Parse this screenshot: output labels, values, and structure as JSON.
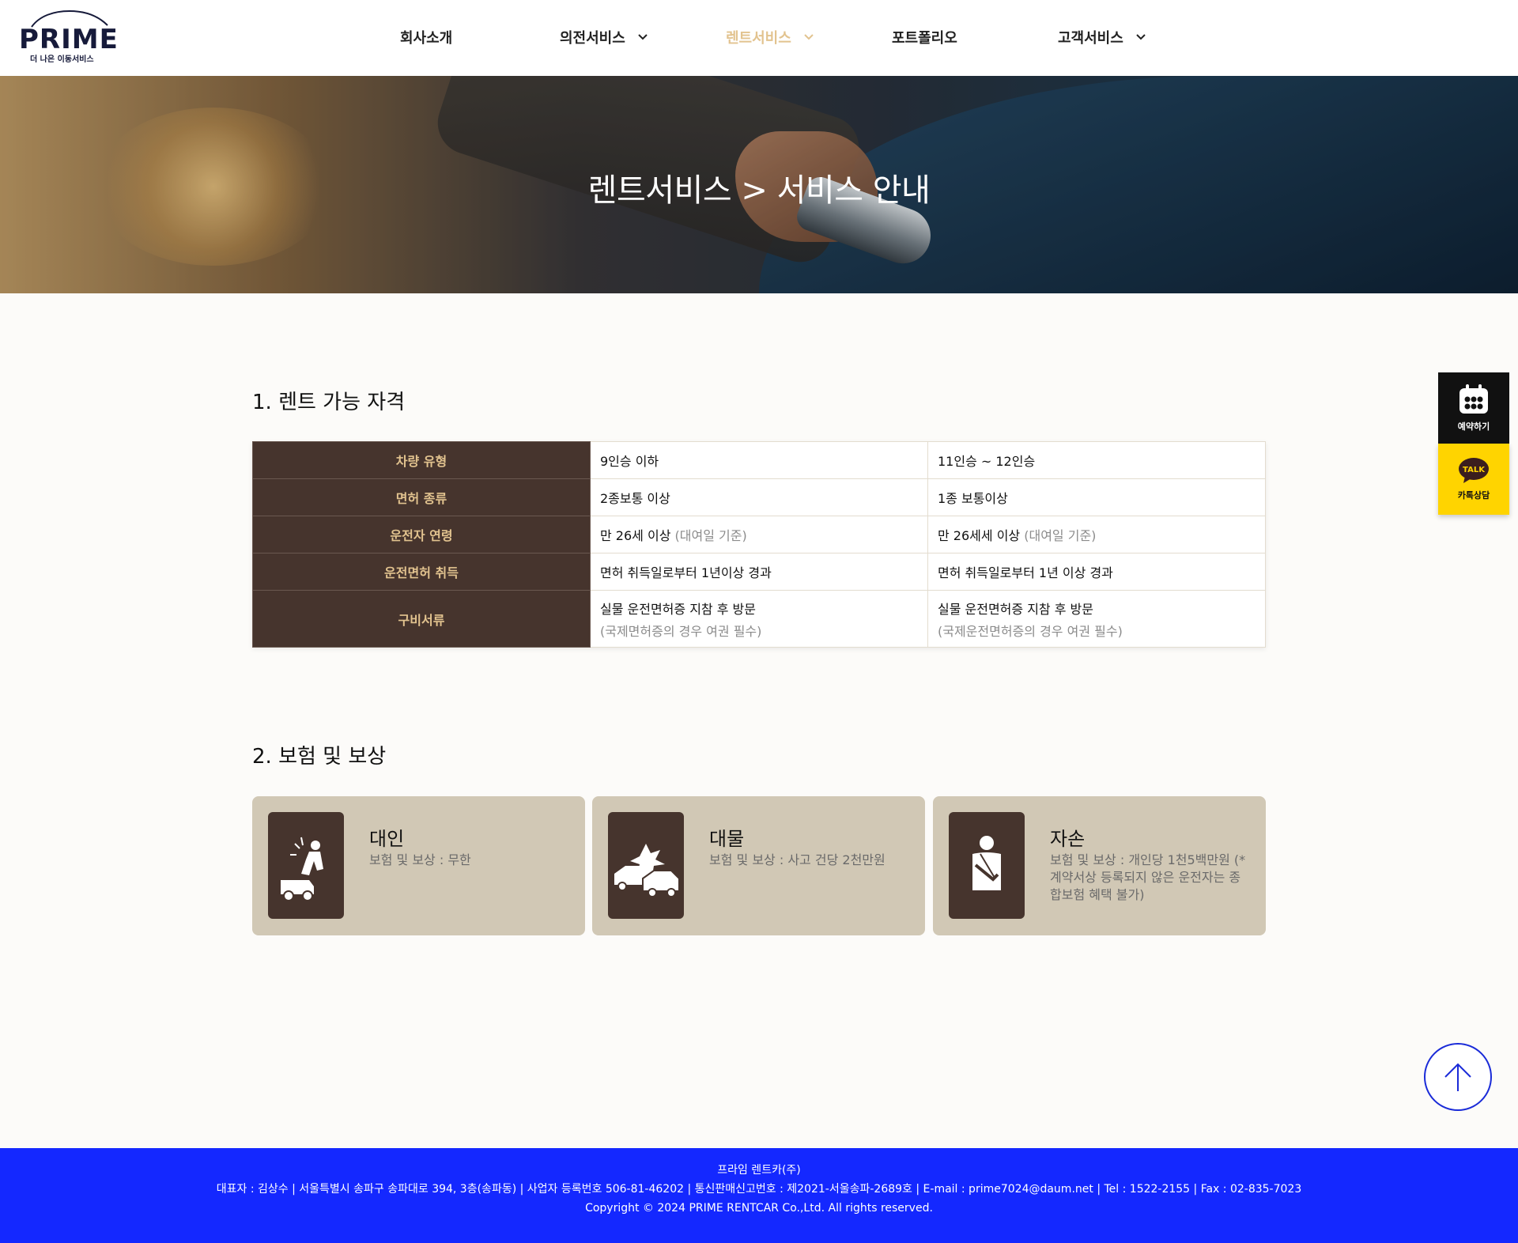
{
  "header": {
    "logo": {
      "word": "PRIME",
      "tagline": "더 나은 이동서비스"
    },
    "nav": [
      {
        "label": "회사소개",
        "has_dropdown": false,
        "active": false
      },
      {
        "label": "의전서비스",
        "has_dropdown": true,
        "active": false
      },
      {
        "label": "렌트서비스",
        "has_dropdown": true,
        "active": true
      },
      {
        "label": "포트폴리오",
        "has_dropdown": false,
        "active": false
      },
      {
        "label": "고객서비스",
        "has_dropdown": true,
        "active": false
      }
    ]
  },
  "hero": {
    "title": "렌트서비스 > 서비스 안내"
  },
  "section1": {
    "title": "1. 렌트 가능 자격",
    "rows": [
      {
        "header": "차량 유형",
        "col1": "9인승 이하",
        "col1_note": "",
        "col2": "11인승 ~ 12인승",
        "col2_note": ""
      },
      {
        "header": "면허 종류",
        "col1": "2종보통 이상",
        "col1_note": "",
        "col2": "1종 보통이상",
        "col2_note": ""
      },
      {
        "header": "운전자 연령",
        "col1": "만 26세 이상",
        "col1_note": "(대여일 기준)",
        "col2": "만 26세세 이상",
        "col2_note": "(대여일 기준)"
      },
      {
        "header": "운전면허 취득",
        "col1": "면허 취득일로부터 1년이상 경과",
        "col1_note": "",
        "col2": "면허 취득일로부터 1년 이상 경과",
        "col2_note": ""
      },
      {
        "header": "구비서류",
        "col1": "실물 운전면허증 지참 후 방문",
        "col1_note": "(국제면허증의 경우 여권 필수)",
        "col2": "실물 운전면허증 지참 후 방문",
        "col2_note": "(국제운전면허증의 경우 여권 필수)"
      }
    ]
  },
  "section2": {
    "title": "2. 보험 및 보상",
    "cards": [
      {
        "title": "대인",
        "desc": "보험 및 보상 : 무한",
        "icon": "injured-person-car-icon"
      },
      {
        "title": "대물",
        "desc": "보험 및 보상 : 사고 건당 2천만원",
        "icon": "car-collision-icon"
      },
      {
        "title": "자손",
        "desc": "보험 및 보상 : 개인당 1천5백만원 (*계약서상 등록되지 않은 운전자는 종합보험 혜택 불가)",
        "icon": "arm-sling-icon"
      }
    ]
  },
  "side": {
    "reserve_label": "예약하기",
    "talk_badge": "TALK",
    "talk_label": "카톡상담"
  },
  "footer": {
    "company": "프라임 렌트카(주)",
    "info": "대표자 : 김상수 | 서울특별시 송파구 송파대로 394, 3층(송파동) | 사업자 등록번호 506-81-46202 | 통신판매신고번호 : 제2021-서울송파-2689호 | E-mail : prime7024@daum.net | Tel : 1522-2155 | Fax : 02-835-7023",
    "copyright": "Copyright © 2024 PRIME RENTCAR Co.,Ltd. All rights reserved."
  },
  "colors": {
    "header_cell_bg": "#46342d",
    "header_cell_text": "#e2c38f",
    "card_bg": "#d1c8b5",
    "nav_active": "#e2c38f",
    "footer_bg": "#1428ff",
    "talk_bg": "#ffd400"
  }
}
